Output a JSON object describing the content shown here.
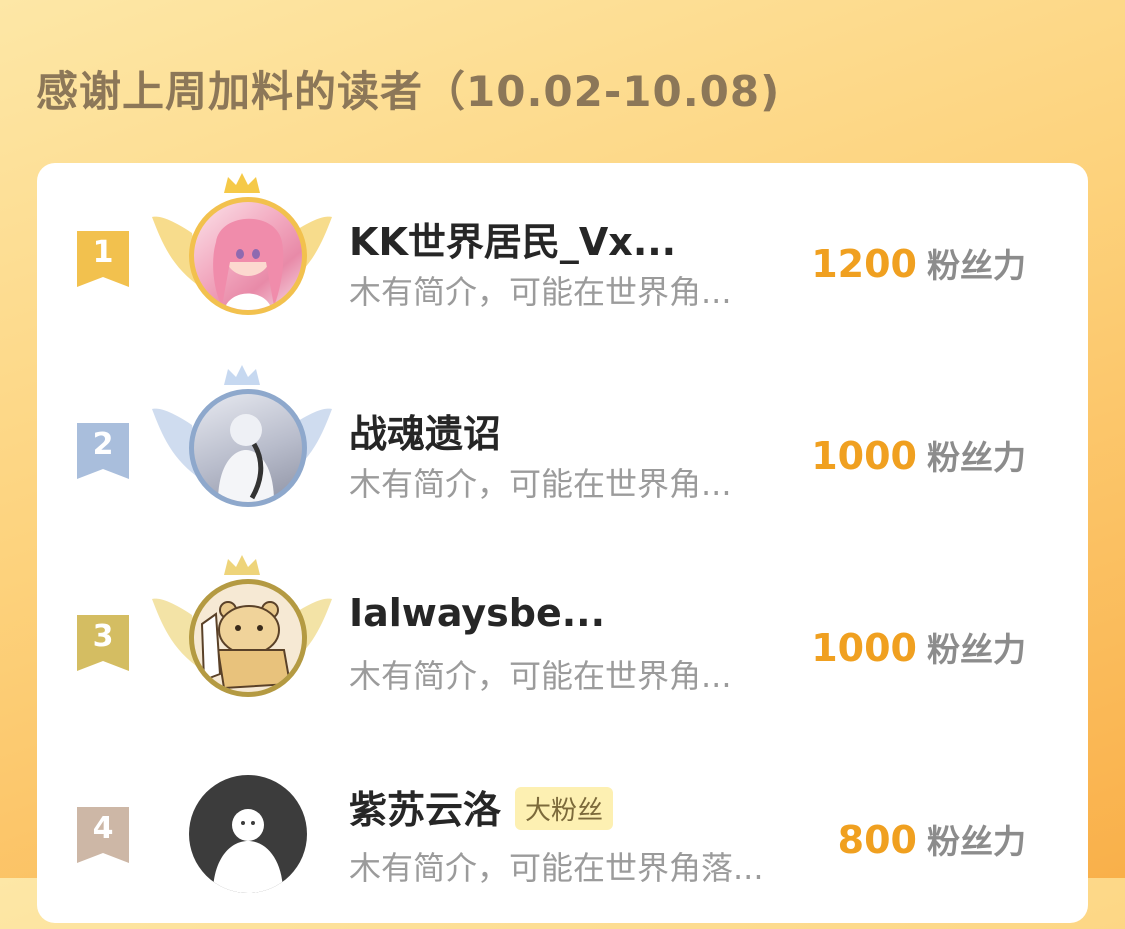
{
  "page": {
    "title": "感谢上周加料的读者（10.02-10.08)"
  },
  "readers": [
    {
      "rank": "1",
      "name": "KK世界居民_Vx...",
      "badge": "",
      "desc": "木有简介，可能在世界角...",
      "score": "1200",
      "unit": "粉丝力",
      "rank_color": "#f2c14e"
    },
    {
      "rank": "2",
      "name": "战魂遗诏",
      "badge": "",
      "desc": "木有简介，可能在世界角...",
      "score": "1000",
      "unit": "粉丝力",
      "rank_color": "#a9bedc"
    },
    {
      "rank": "3",
      "name": "Ialwaysbe...",
      "badge": "",
      "desc": "木有简介，可能在世界角...",
      "score": "1000",
      "unit": "粉丝力",
      "rank_color": "#d4bd62"
    },
    {
      "rank": "4",
      "name": "紫苏云洛",
      "badge": "大粉丝",
      "desc": "木有简介，可能在世界角落...",
      "score": "800",
      "unit": "粉丝力",
      "rank_color": "#cdb7a6"
    }
  ],
  "icons": [
    "crown-icon",
    "wings-icon",
    "rank-ribbon-icon",
    "avatar-image"
  ]
}
